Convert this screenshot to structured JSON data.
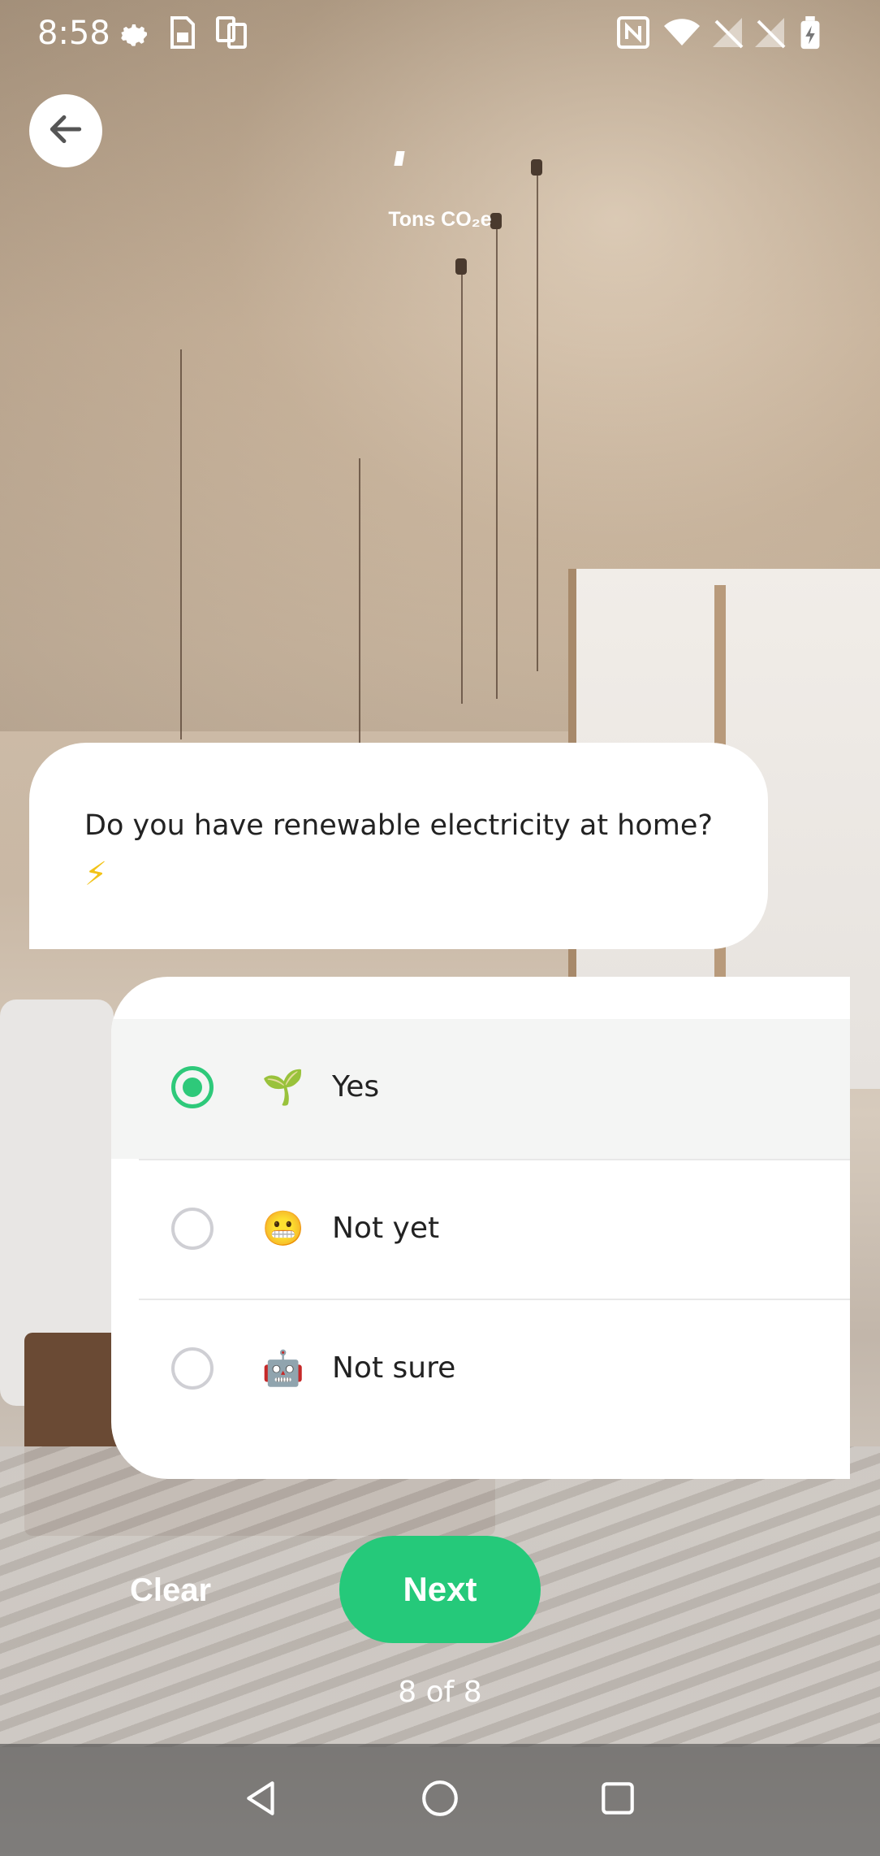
{
  "status_bar": {
    "time": "8:58"
  },
  "header": {
    "co2_unit": "Tons CO₂e"
  },
  "question": {
    "text": "Do you have renewable electricity at home?",
    "emoji": "⚡"
  },
  "options": [
    {
      "emoji": "🌱",
      "label": "Yes",
      "selected": true
    },
    {
      "emoji": "😬",
      "label": "Not yet",
      "selected": false
    },
    {
      "emoji": "🤖",
      "label": "Not sure",
      "selected": false
    }
  ],
  "actions": {
    "clear_label": "Clear",
    "next_label": "Next"
  },
  "progress": {
    "text": "8 of 8",
    "current": 8,
    "total": 8
  },
  "colors": {
    "accent": "#25c97a",
    "radio_selected": "#2ec97a",
    "card_background": "#ffffff"
  },
  "icons": {
    "back": "arrow-left-icon",
    "status": [
      "settings-icon",
      "sim-card-icon",
      "screen-mirror-icon",
      "nfc-icon",
      "wifi-icon",
      "signal-off-icon",
      "signal-off-icon",
      "battery-charging-icon"
    ],
    "nav": [
      "nav-back-icon",
      "nav-home-icon",
      "nav-recents-icon"
    ]
  }
}
